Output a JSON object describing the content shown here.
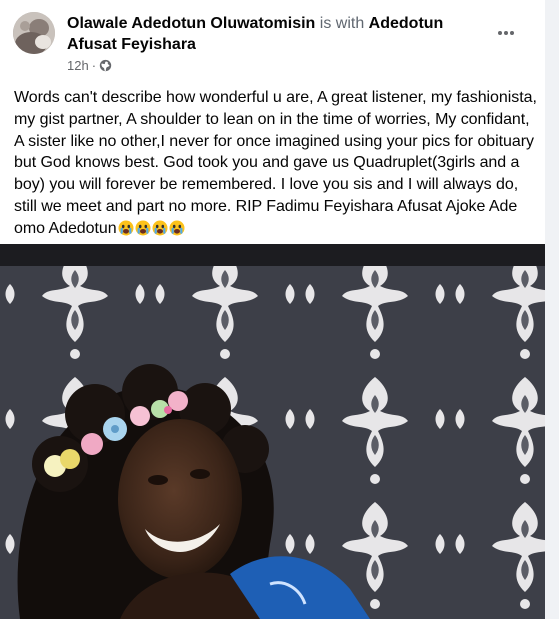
{
  "post": {
    "author": "Olawale Adedotun Oluwatomisin",
    "with_text": " is with ",
    "tagged": "Adedotun Afusat Feyishara",
    "time": "12h",
    "separator": "·",
    "privacy_icon": "globe-icon",
    "more_icon": "more-horizontal-icon",
    "text": "Words can't describe how wonderful u are, A great listener, my fashionista, my gist partner, A shoulder to lean on in the time of worries, My confidant, A sister like no other,I never for once imagined using your pics for obituary but God knows best. God took you and gave us Quadruplet(3girls and a boy) you will forever be remembered. I love you sis and I will always do, still we meet and part no more. RIP Fadimu Feyishara Afusat Ajoke Ade omo Adedotun",
    "emojis": [
      "crying-face-emoji",
      "crying-face-emoji",
      "crying-face-emoji",
      "crying-face-emoji"
    ],
    "photo": "woman-with-flower-crown-photo"
  },
  "colors": {
    "name": "#050505",
    "secondary": "#65676b",
    "background": "#f0f2f5",
    "card": "#ffffff"
  }
}
